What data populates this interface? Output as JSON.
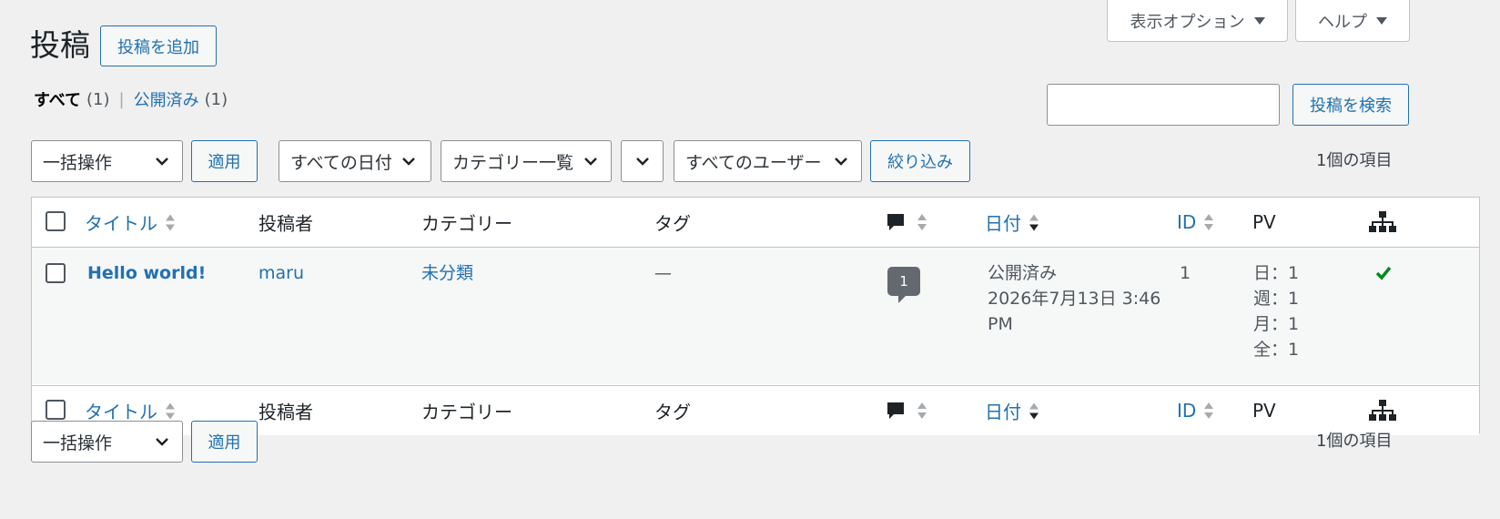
{
  "header": {
    "title": "投稿",
    "add_new": "投稿を追加",
    "screen_options": "表示オプション",
    "help": "ヘルプ"
  },
  "views": {
    "all_label": "すべて",
    "all_count": "(1)",
    "separator": "|",
    "published_label": "公開済み",
    "published_count": "(1)"
  },
  "search": {
    "value": "",
    "button": "投稿を検索"
  },
  "filters": {
    "bulk_action": "一括操作",
    "apply": "適用",
    "dates": "すべての日付",
    "categories": "カテゴリー一覧",
    "extra": "",
    "users": "すべてのユーザー",
    "filter_button": "絞り込み",
    "item_count": "1個の項目"
  },
  "columns": {
    "title": "タイトル",
    "author": "投稿者",
    "categories": "カテゴリー",
    "tags": "タグ",
    "date": "日付",
    "id": "ID",
    "pv": "PV"
  },
  "rows": [
    {
      "title": "Hello world!",
      "author": "maru",
      "category": "未分類",
      "tags": "—",
      "comments": "1",
      "status": "公開済み",
      "date_line1": "2026年7月13日 3:46",
      "date_line2": "PM",
      "id": "1",
      "pv_day": "日：1",
      "pv_week": "週：1",
      "pv_month": "月：1",
      "pv_all": "全：1"
    }
  ],
  "bottom": {
    "bulk_action": "一括操作",
    "apply": "適用",
    "item_count": "1個の項目"
  },
  "colors": {
    "accent": "#2271b1",
    "background": "#f0f0f1",
    "check_green": "#008a20"
  }
}
